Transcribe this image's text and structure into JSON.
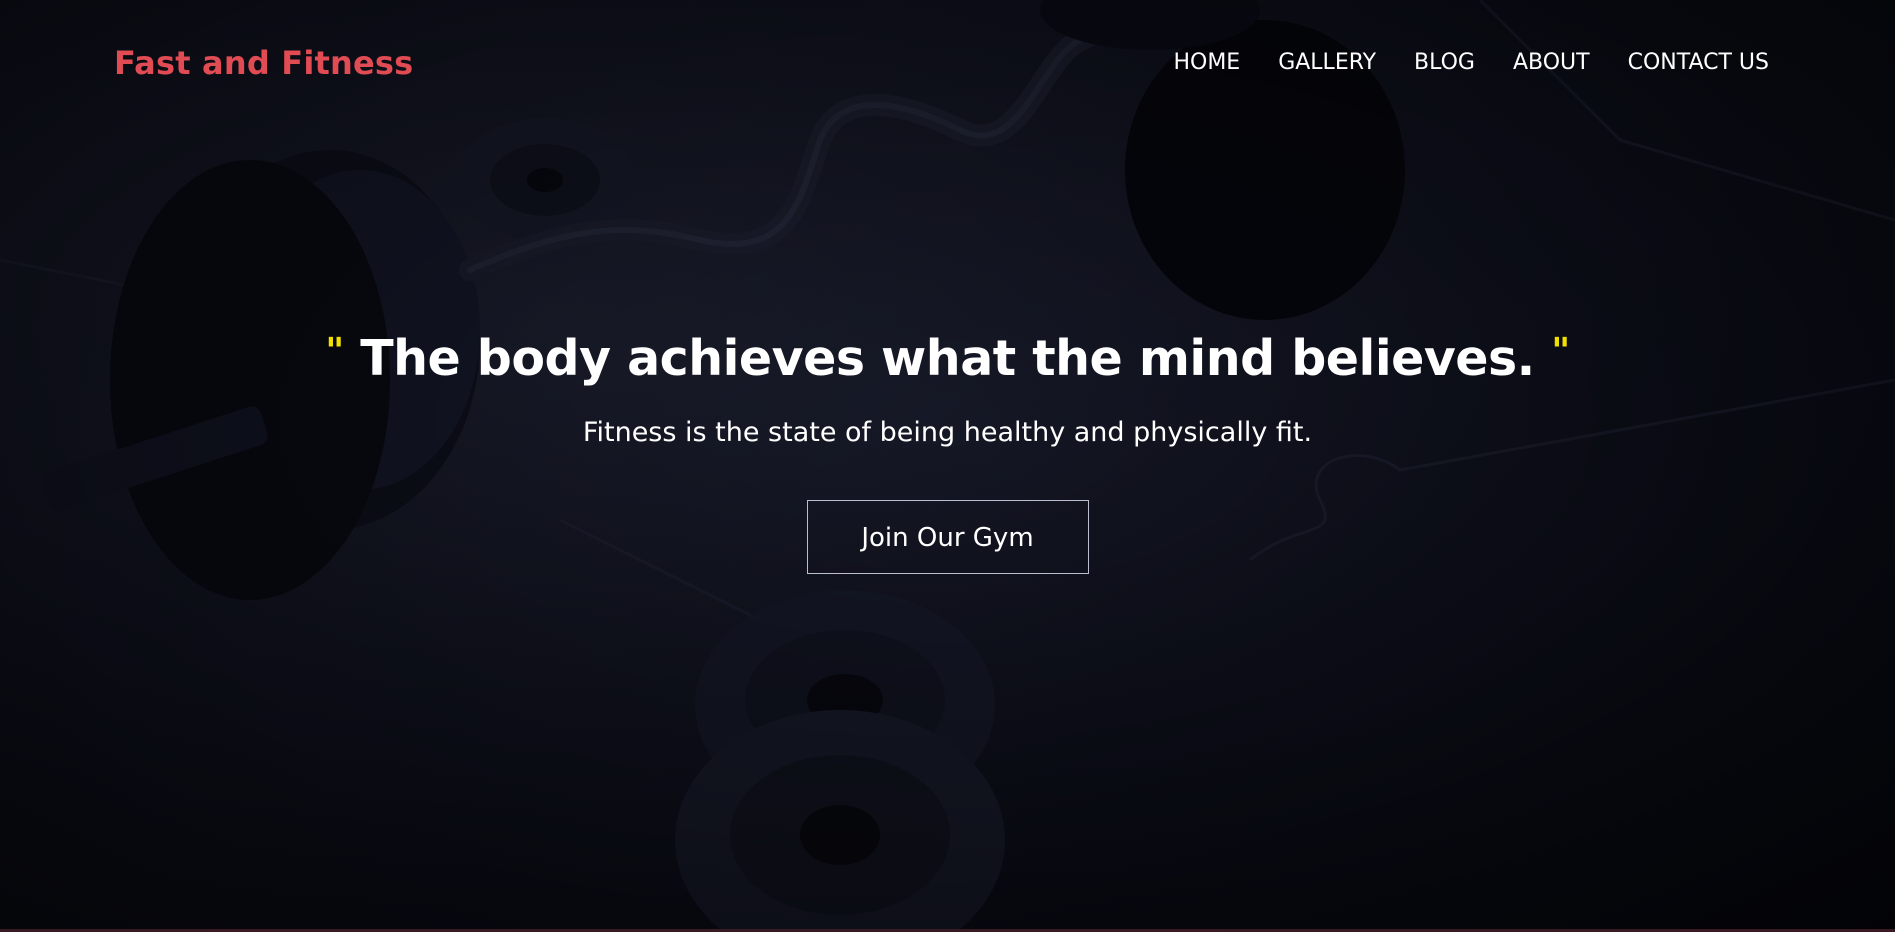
{
  "brand": {
    "name": "Fast and Fitness"
  },
  "nav": {
    "items": [
      {
        "label": "HOME"
      },
      {
        "label": "GALLERY"
      },
      {
        "label": "BLOG"
      },
      {
        "label": "ABOUT"
      },
      {
        "label": "CONTACT US"
      }
    ]
  },
  "hero": {
    "quote_open": "\"",
    "quote_text": "The body achieves what the mind believes.",
    "quote_close": "\"",
    "subtitle": "Fitness is the state of being healthy and physically fit.",
    "cta_label": "Join Our Gym"
  },
  "colors": {
    "brand": "#e04b54",
    "quote_marks": "#f2e000",
    "background": "#0b0d18",
    "text": "#ffffff"
  }
}
